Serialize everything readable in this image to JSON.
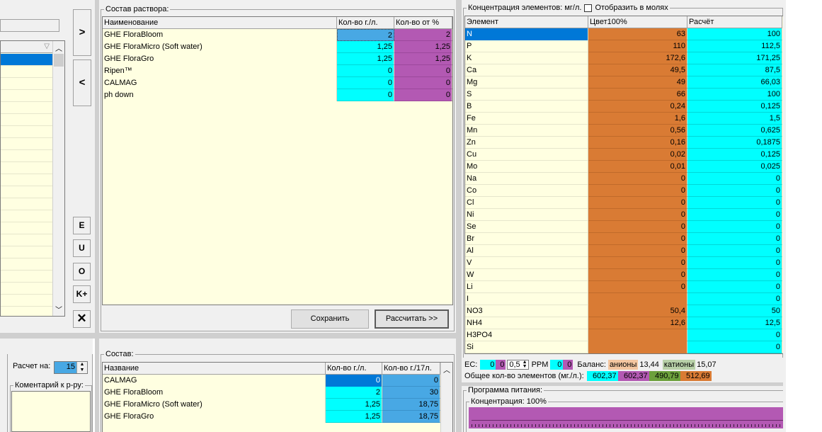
{
  "left_panel": {
    "list_count": 22
  },
  "arrow_right": ">",
  "arrow_left": "<",
  "side_buttons": [
    "E",
    "U",
    "O",
    "K+"
  ],
  "close_symbol": "✕",
  "solution": {
    "label": "Состав раствора:",
    "headers": [
      "Наименование",
      "Кол-во г./л.",
      "Кол-во от %"
    ],
    "rows": [
      {
        "name": "GHE FloraBloom",
        "qty": "2",
        "pct": "2"
      },
      {
        "name": "GHE FloraMicro (Soft water)",
        "qty": "1,25",
        "pct": "1,25"
      },
      {
        "name": "GHE FloraGro",
        "qty": "1,25",
        "pct": "1,25"
      },
      {
        "name": "Ripen™",
        "qty": "0",
        "pct": "0"
      },
      {
        "name": "CALMAG",
        "qty": "0",
        "pct": "0"
      },
      {
        "name": "ph down",
        "qty": "0",
        "pct": "0"
      }
    ],
    "save_label": "Сохранить",
    "calc_label": "Рассчитать >>"
  },
  "composition": {
    "label": "Состав:",
    "headers": [
      "Название",
      "Кол-во г./л.",
      "Кол-во г./17л."
    ],
    "rows": [
      {
        "name": "CALMAG",
        "qty": "0",
        "per17": "0"
      },
      {
        "name": "GHE FloraBloom",
        "qty": "2",
        "per17": "30"
      },
      {
        "name": "GHE FloraMicro (Soft water)",
        "qty": "1,25",
        "per17": "18,75"
      },
      {
        "name": "GHE FloraGro",
        "qty": "1,25",
        "per17": "18,75"
      }
    ]
  },
  "calc": {
    "label": "Расчет на:",
    "value": "15",
    "comment_label": "Коментарий к р-ру:"
  },
  "concentration": {
    "label": "Концентрация элементов: мг/л.",
    "moles_label": "Отобразить в молях",
    "headers": [
      "Элемент",
      "Цвет100%",
      "Расчёт"
    ],
    "rows": [
      {
        "el": "N",
        "target": "63",
        "calc": "100"
      },
      {
        "el": "P",
        "target": "110",
        "calc": "112,5"
      },
      {
        "el": "K",
        "target": "172,6",
        "calc": "171,25"
      },
      {
        "el": "Ca",
        "target": "49,5",
        "calc": "87,5"
      },
      {
        "el": "Mg",
        "target": "49",
        "calc": "66,03"
      },
      {
        "el": "S",
        "target": "66",
        "calc": "100"
      },
      {
        "el": "B",
        "target": "0,24",
        "calc": "0,125"
      },
      {
        "el": "Fe",
        "target": "1,6",
        "calc": "1,5"
      },
      {
        "el": "Mn",
        "target": "0,56",
        "calc": "0,625"
      },
      {
        "el": "Zn",
        "target": "0,16",
        "calc": "0,1875"
      },
      {
        "el": "Cu",
        "target": "0,02",
        "calc": "0,125"
      },
      {
        "el": "Mo",
        "target": "0,01",
        "calc": "0,025"
      },
      {
        "el": "Na",
        "target": "0",
        "calc": "0"
      },
      {
        "el": "Co",
        "target": "0",
        "calc": "0"
      },
      {
        "el": "Cl",
        "target": "0",
        "calc": "0"
      },
      {
        "el": "Ni",
        "target": "0",
        "calc": "0"
      },
      {
        "el": "Se",
        "target": "0",
        "calc": "0"
      },
      {
        "el": "Br",
        "target": "0",
        "calc": "0"
      },
      {
        "el": "Al",
        "target": "0",
        "calc": "0"
      },
      {
        "el": "V",
        "target": "0",
        "calc": "0"
      },
      {
        "el": "W",
        "target": "0",
        "calc": "0"
      },
      {
        "el": "Li",
        "target": "0",
        "calc": "0"
      },
      {
        "el": "I",
        "target": "",
        "calc": "0"
      },
      {
        "el": "NO3",
        "target": "50,4",
        "calc": "50"
      },
      {
        "el": "NH4",
        "target": "12,6",
        "calc": "12,5"
      },
      {
        "el": "H3PO4",
        "target": "",
        "calc": "0"
      },
      {
        "el": "Si",
        "target": "",
        "calc": "0"
      }
    ]
  },
  "status": {
    "ec_label": "EC:",
    "ec_a": "0",
    "ec_b": "0",
    "ec_step": "0,5",
    "ppm_label": "PPM",
    "ppm_a": "0",
    "ppm_b": "0",
    "balance_label": "Баланс:",
    "anions_label": "анионы",
    "anions": "13,44",
    "cations_label": "катионы",
    "cations": "15,07",
    "total_label": "Общее кол-во элементов (мг./л.):",
    "totals": [
      "602,37",
      "602,37",
      "490,79",
      "512,69"
    ]
  },
  "program": {
    "label": "Программа питания:",
    "conc_label": "Концентрация: 100%"
  },
  "colors": {
    "orange": "#d97b34",
    "cyan": "#00ffff",
    "purple": "#b359b3",
    "blue": "#48a8e4",
    "green": "#6ca03c",
    "selection": "#0078d7",
    "grid_bg": "#ffffe1"
  }
}
